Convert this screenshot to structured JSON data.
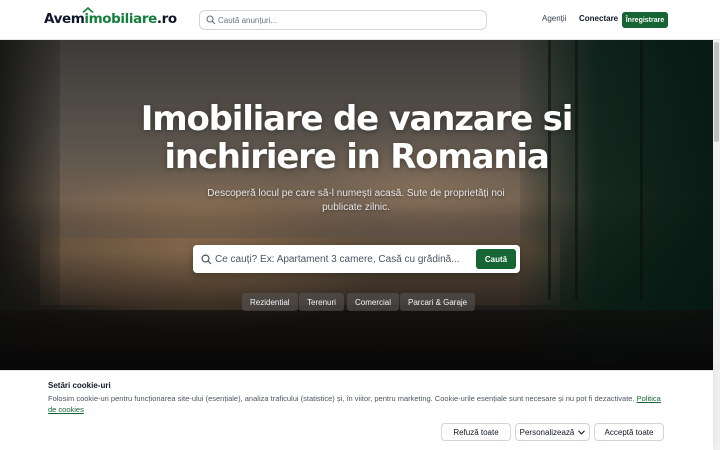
{
  "header": {
    "logo_prefix": "Avem",
    "logo_accent": "imobiliare",
    "logo_suffix": ".ro",
    "search_placeholder": "Caută anunțuri...",
    "nav_agents": "Agenții",
    "nav_login": "Conectare",
    "register_button": "Înregistrare"
  },
  "hero": {
    "title": "Imobiliare de vanzare si inchiriere in Romania",
    "subtitle": "Descoperă locul pe care să-l numești acasă. Sute de proprietăți noi publicate zilnic.",
    "search_placeholder": "Ce cauți? Ex: Apartament 3 camere, Casă cu grădină...",
    "search_button": "Caută",
    "categories": [
      "Rezidential",
      "Terenuri",
      "Comercial",
      "Parcari & Garaje"
    ]
  },
  "cookie_banner": {
    "title": "Setări cookie-uri",
    "text": "Folosim cookie-uri pentru funcționarea site-ului (esențiale), analiza traficului (statistice) și, în viitor, pentru marketing. Cookie-urile esențiale sunt necesare și nu pot fi dezactivate.",
    "policy_link": "Politica de cookies",
    "refuse_button": "Refuză toate",
    "customize_button": "Personalizează",
    "accept_button": "Acceptă toate"
  },
  "colors": {
    "brand_green": "#166534",
    "text_dark": "#111827"
  },
  "icons": [
    "search-icon",
    "roof-icon",
    "chevron-down-icon"
  ]
}
